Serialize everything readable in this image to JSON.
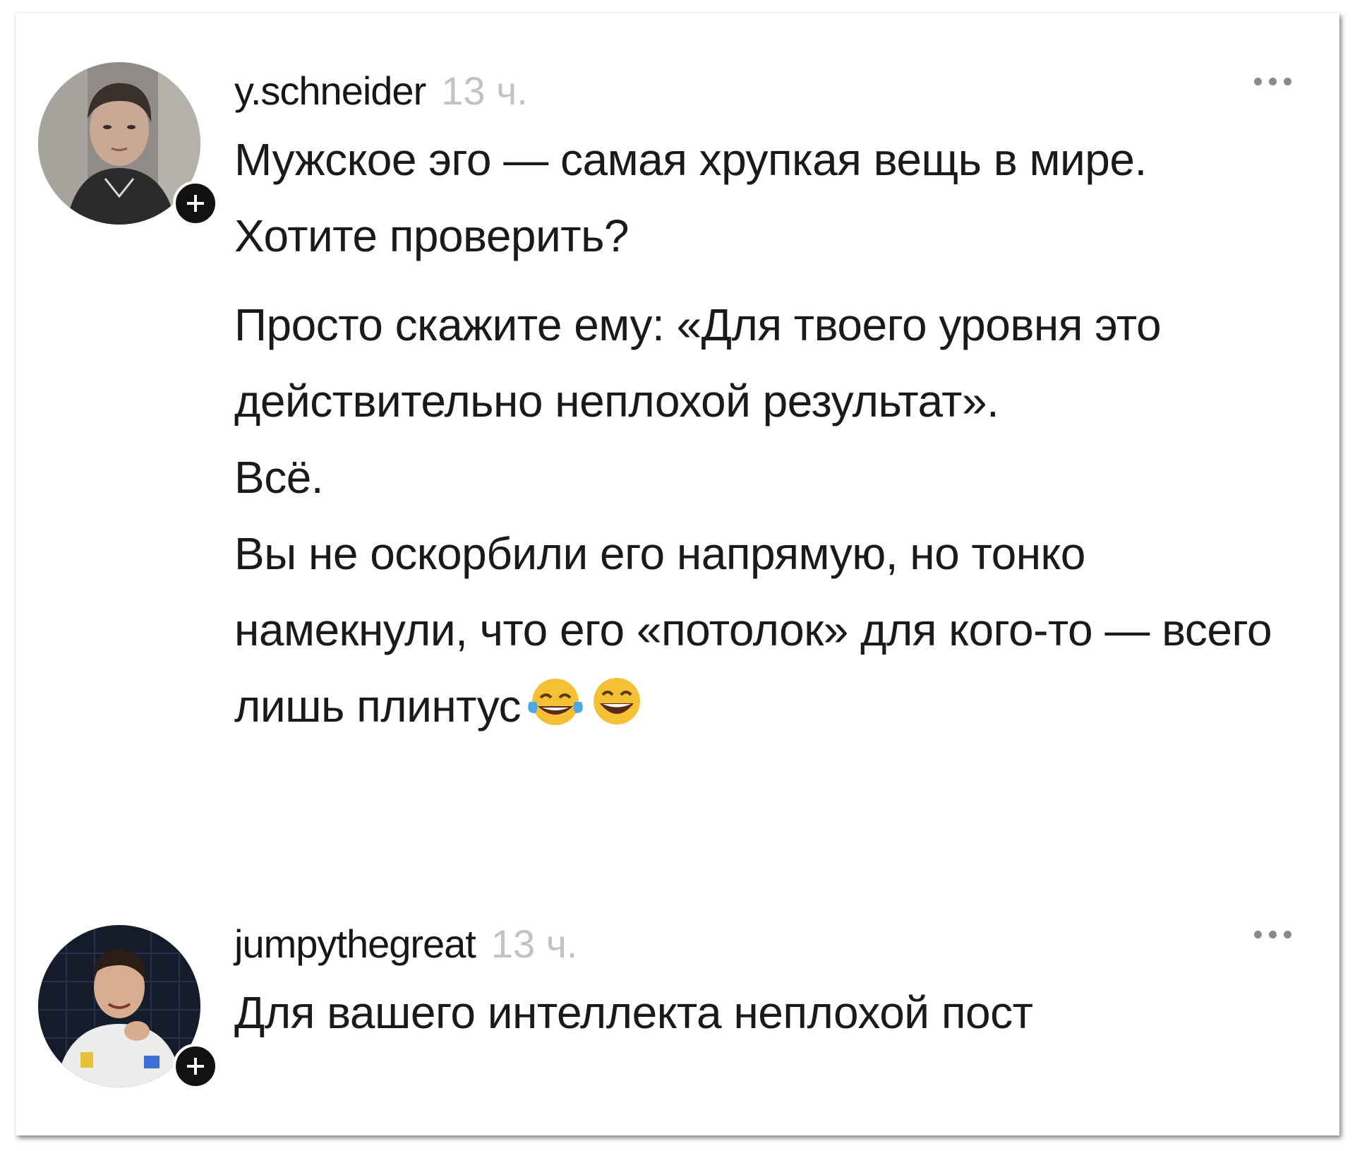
{
  "comments": [
    {
      "username": "y.schneider",
      "time": "13 ч.",
      "avatar": "user-photo-avatar",
      "follow_icon": "plus-icon",
      "more_icon": "more-dots-icon",
      "paragraphs": [
        "Мужское эго — самая хрупкая вещь в мире. Хотите проверить?",
        "Просто скажите ему: «Для твоего уровня это действительно неплохой результат».",
        "Всё.",
        "Вы не оскорбили его напрямую, но тонко намекнули, что его «потолок» для кого-то — всего лишь плинтус"
      ],
      "emojis": [
        "tears-of-joy-emoji",
        "grinning-squinting-emoji"
      ]
    },
    {
      "username": "jumpythegreat",
      "time": "13 ч.",
      "avatar": "user-photo-avatar",
      "follow_icon": "plus-icon",
      "more_icon": "more-dots-icon",
      "paragraphs": [
        "Для вашего интеллекта неплохой пост"
      ]
    }
  ],
  "colors": {
    "username": "#161616",
    "time": "#c2c2c2",
    "text": "#1a1a1a",
    "badge": "#111111"
  }
}
